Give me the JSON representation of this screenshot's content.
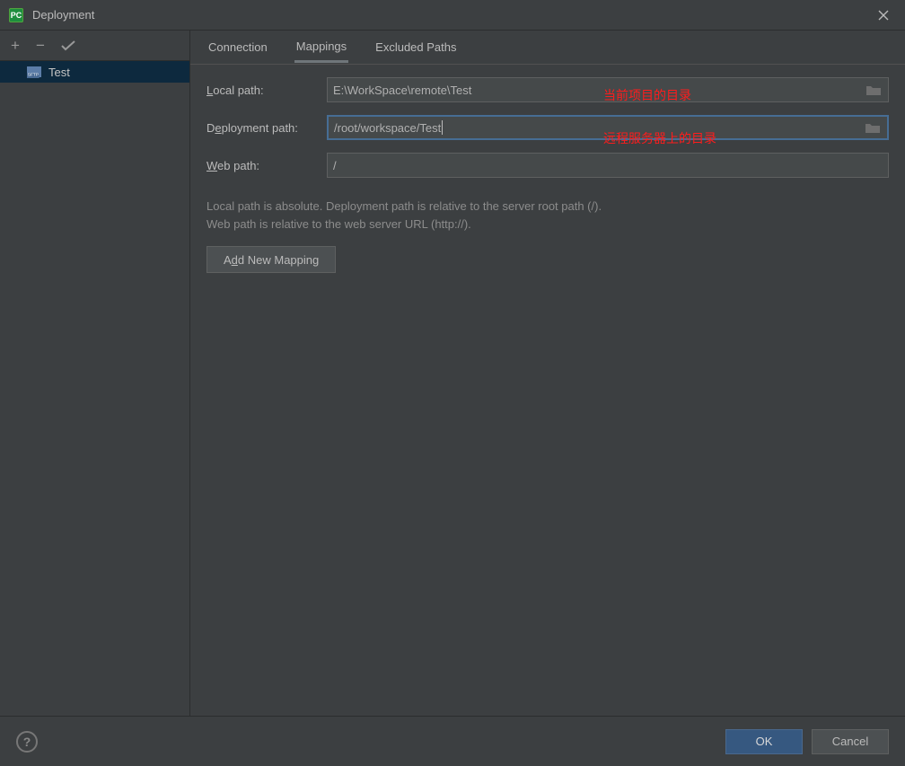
{
  "window": {
    "title": "Deployment"
  },
  "toolbar": {
    "add": "+",
    "remove": "−",
    "check": "✓"
  },
  "sidebar": {
    "server": {
      "name": "Test",
      "type": "SFTP"
    }
  },
  "tabs": {
    "connection": "Connection",
    "mappings": "Mappings",
    "excluded": "Excluded Paths"
  },
  "form": {
    "local_path_label_pre": "L",
    "local_path_label_post": "ocal path:",
    "local_path_value": "E:\\WorkSpace\\remote\\Test",
    "deployment_path_label_pre": "D",
    "deployment_path_label_mid": "e",
    "deployment_path_label_post": "ployment path:",
    "deployment_path_value": "/root/workspace/Test",
    "web_path_label_pre": "W",
    "web_path_label_post": "eb path:",
    "web_path_value": "/"
  },
  "annotations": {
    "local": "当前项目的目录",
    "remote": "远程服务器上的目录"
  },
  "help": {
    "line1": "Local path is absolute. Deployment path is relative to the server root path (/).",
    "line2": "Web path is relative to the web server URL (http://)."
  },
  "buttons": {
    "add_mapping_pre": "A",
    "add_mapping_mid": "d",
    "add_mapping_post": "d New Mapping",
    "ok": "OK",
    "cancel": "Cancel",
    "help": "?"
  }
}
